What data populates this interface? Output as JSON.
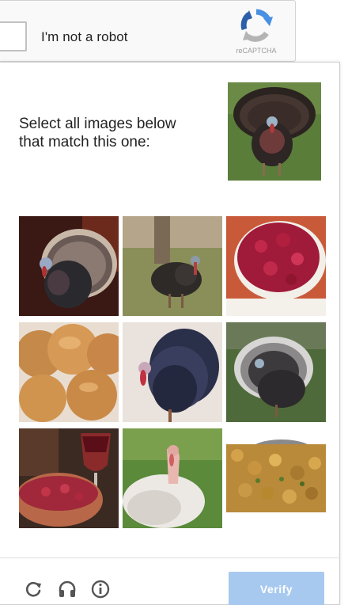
{
  "checkbox": {
    "label": "I'm not a robot",
    "checked": false,
    "logo_text": "reCAPTCHA",
    "logo_icon": "recaptcha-logo-icon"
  },
  "challenge": {
    "prompt_line1": "Select all images below",
    "prompt_line2": "that match this one:",
    "reference_image": "turkey",
    "tiles": [
      {
        "subject": "turkey-fanned-tail"
      },
      {
        "subject": "turkey-walking-field"
      },
      {
        "subject": "cranberry-sauce-bowl"
      },
      {
        "subject": "dinner-rolls"
      },
      {
        "subject": "turkey-strutting"
      },
      {
        "subject": "turkey-displaying-grass"
      },
      {
        "subject": "wine-glass-and-cranberries"
      },
      {
        "subject": "white-turkey"
      },
      {
        "subject": "stuffing"
      }
    ]
  },
  "footer": {
    "reload_icon": "reload-icon",
    "audio_icon": "headphones-icon",
    "info_icon": "info-icon",
    "verify_label": "Verify"
  },
  "colors": {
    "verify_disabled": "#a8c9ef",
    "recaptcha_blue": "#4a90e2",
    "recaptcha_gray": "#b4b4b4"
  }
}
